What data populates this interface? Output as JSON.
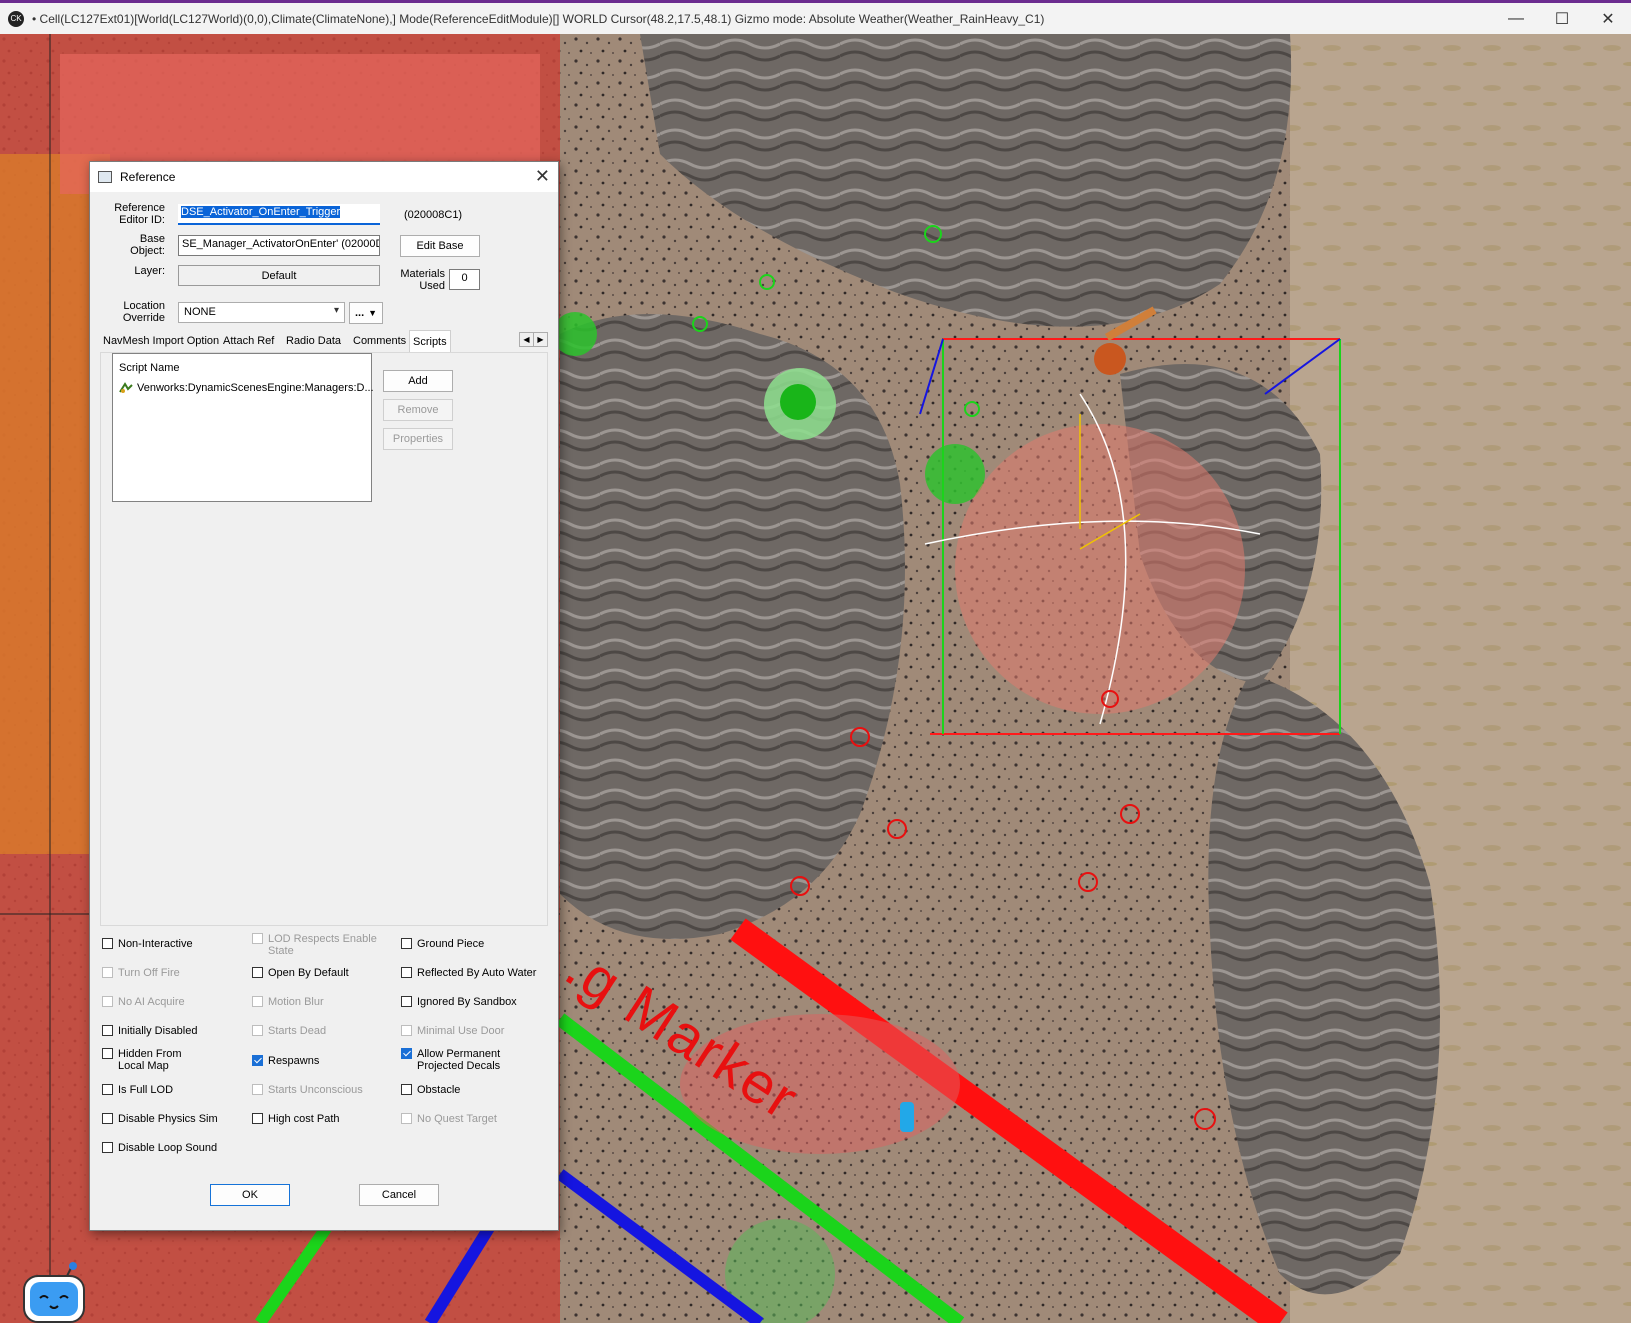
{
  "window": {
    "title": "• Cell(LC127Ext01)[World(LC127World)(0,0),Climate(ClimateNone),] Mode(ReferenceEditModule)[] WORLD  Cursor(48.2,17.5,48.1)  Gizmo mode: Absolute Weather(Weather_RainHeavy_C1)",
    "app_icon": "CK",
    "minimize_icon": "—",
    "maximize_icon": "☐",
    "close_icon": "✕"
  },
  "viewport": {
    "marker_label": "...g Marker",
    "colors": {
      "red": "#ff1010",
      "green": "#1bd41b",
      "blue": "#1515e0",
      "terrain": "#9b8676",
      "rock": "#6d6763"
    }
  },
  "dialog": {
    "title": "Reference",
    "close_icon": "✕",
    "ref_editor_id_label_1": "Reference",
    "ref_editor_id_label_2": "Editor ID:",
    "ref_editor_id_value": "DSE_Activator_OnEnter_Trigger",
    "form_id": "(020008C1)",
    "base_object_label_1": "Base",
    "base_object_label_2": "Object:",
    "base_object_value": "SE_Manager_ActivatorOnEnter' (02000DE",
    "edit_base_button": "Edit Base",
    "layer_label": "Layer:",
    "layer_value": "Default",
    "materials_used_label_1": "Materials",
    "materials_used_label_2": "Used",
    "materials_used_value": "0",
    "location_override_label_1": "Location",
    "location_override_label_2": "Override",
    "location_override_value": "NONE",
    "location_more_button": "...",
    "tabs": [
      "NavMesh Import Option",
      "Attach Ref",
      "Radio Data",
      "Comments",
      "Scripts"
    ],
    "active_tab": "Scripts",
    "scripts": {
      "header": "Script Name",
      "items": [
        "Venworks:DynamicScenesEngine:Managers:D..."
      ],
      "add_button": "Add",
      "remove_button": "Remove",
      "properties_button": "Properties"
    },
    "flags": {
      "col1": [
        {
          "label": "Non-Interactive",
          "checked": false,
          "disabled": false
        },
        {
          "label": "Turn Off Fire",
          "checked": false,
          "disabled": true
        },
        {
          "label": "No AI Acquire",
          "checked": false,
          "disabled": true
        },
        {
          "label": "Initially Disabled",
          "checked": false,
          "disabled": false
        },
        {
          "label": "Hidden From Local Map",
          "checked": false,
          "disabled": false
        },
        {
          "label": "Is Full LOD",
          "checked": false,
          "disabled": false
        },
        {
          "label": "Disable Physics Sim",
          "checked": false,
          "disabled": false
        },
        {
          "label": "Disable Loop Sound",
          "checked": false,
          "disabled": false
        }
      ],
      "col2": [
        {
          "label": "LOD Respects Enable State",
          "checked": false,
          "disabled": true
        },
        {
          "label": "Open By Default",
          "checked": false,
          "disabled": false
        },
        {
          "label": "Motion Blur",
          "checked": false,
          "disabled": true
        },
        {
          "label": "Starts Dead",
          "checked": false,
          "disabled": true
        },
        {
          "label": "Respawns",
          "checked": true,
          "disabled": false
        },
        {
          "label": "Starts Unconscious",
          "checked": false,
          "disabled": true
        },
        {
          "label": "High cost Path",
          "checked": false,
          "disabled": false
        }
      ],
      "col3": [
        {
          "label": "Ground Piece",
          "checked": false,
          "disabled": false
        },
        {
          "label": "Reflected By Auto Water",
          "checked": false,
          "disabled": false
        },
        {
          "label": "Ignored By Sandbox",
          "checked": false,
          "disabled": false
        },
        {
          "label": "Minimal Use Door",
          "checked": false,
          "disabled": true
        },
        {
          "label": "Allow Permanent Projected Decals",
          "checked": true,
          "disabled": false
        },
        {
          "label": "Obstacle",
          "checked": false,
          "disabled": false
        },
        {
          "label": "No Quest Target",
          "checked": false,
          "disabled": true
        }
      ]
    },
    "ok_button": "OK",
    "cancel_button": "Cancel"
  }
}
